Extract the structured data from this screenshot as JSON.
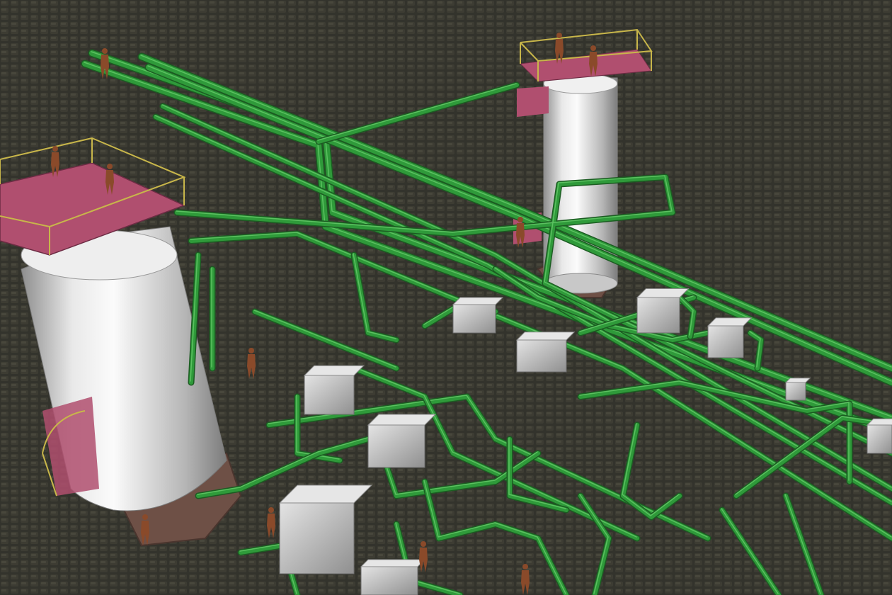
{
  "viewport": {
    "view_mode": "3d-shaded",
    "background_color": "#33332c",
    "floor_tile_color": "#3c3b33"
  },
  "scene": {
    "colors": {
      "pipe": "#2f9a3a",
      "pipe_highlight": "#7fe07f",
      "pipe_shadow": "#1c5c22",
      "vessel_light": "#f2f2f2",
      "vessel_dark": "#9a9a9a",
      "platform_deck": "#b0506e",
      "railing": "#c8b64a",
      "equipment": "#c9c9c9",
      "foundation": "#7a5a4e",
      "worker": "#8a4a2a"
    },
    "objects": [
      {
        "kind": "vessel",
        "name": "vessel-large"
      },
      {
        "kind": "vessel",
        "name": "vessel-tall"
      },
      {
        "kind": "platform",
        "name": "platform-top-large-vessel"
      },
      {
        "kind": "platform",
        "name": "platform-top-tall-vessel"
      },
      {
        "kind": "pipe-rack",
        "name": "main-pipe-rack"
      },
      {
        "kind": "pump",
        "name": "pump-1"
      },
      {
        "kind": "pump",
        "name": "pump-2"
      },
      {
        "kind": "pump",
        "name": "pump-3"
      },
      {
        "kind": "pump",
        "name": "pump-4"
      },
      {
        "kind": "pump",
        "name": "pump-5"
      },
      {
        "kind": "pump",
        "name": "pump-6"
      },
      {
        "kind": "pump",
        "name": "pump-7"
      }
    ]
  }
}
